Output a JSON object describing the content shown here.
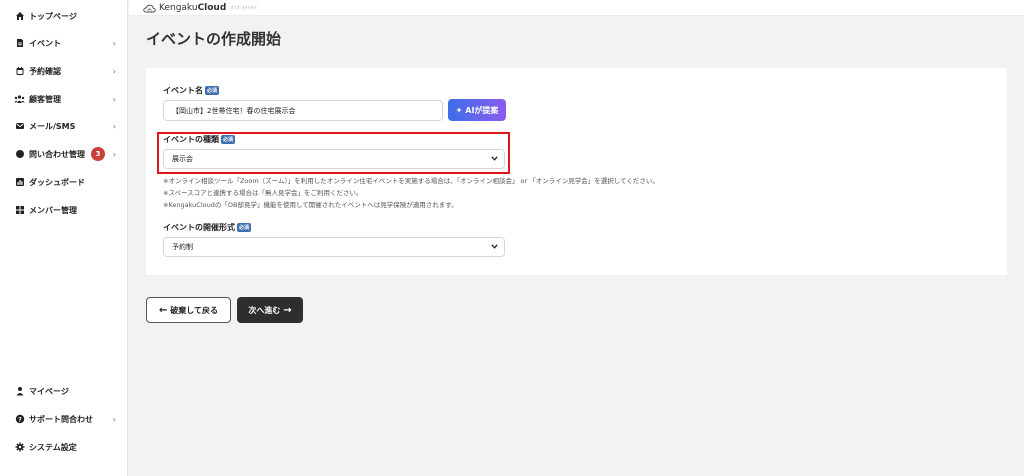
{
  "sidebar": {
    "items": [
      {
        "label": "トップページ",
        "icon": "home-icon",
        "chevron": false
      },
      {
        "label": "イベント",
        "icon": "document-icon",
        "chevron": true
      },
      {
        "label": "予約確認",
        "icon": "calendar-icon",
        "chevron": true
      },
      {
        "label": "顧客管理",
        "icon": "users-icon",
        "chevron": true
      },
      {
        "label": "メール/SMS",
        "icon": "mail-icon",
        "chevron": true
      },
      {
        "label": "問い合わせ管理",
        "icon": "chat-icon",
        "chevron": true,
        "badge": "3"
      },
      {
        "label": "ダッシュボード",
        "icon": "chart-icon",
        "chevron": false
      },
      {
        "label": "メンバー管理",
        "icon": "grid-icon",
        "chevron": false
      }
    ],
    "bottom_items": [
      {
        "label": "マイページ",
        "icon": "person-icon",
        "chevron": false
      },
      {
        "label": "サポート問合わせ",
        "icon": "help-icon",
        "chevron": true
      },
      {
        "label": "システム設定",
        "icon": "gear-icon",
        "chevron": false
      }
    ]
  },
  "header": {
    "logo_prefix": "Kengaku",
    "logo_bold": "Cloud",
    "logo_sub": "ｹﾝｶﾞｸｸﾗｳﾄﾞ"
  },
  "page": {
    "title": "イベントの作成開始"
  },
  "form": {
    "required_label": "必須",
    "event_name": {
      "label": "イベント名",
      "value": "【岡山市】2世帯住宅！春の住宅展示会"
    },
    "ai_button_label": "AIが提案",
    "event_type": {
      "label": "イベントの種類",
      "selected": "展示会"
    },
    "notes": [
      "※オンライン相談ツール「Zoom（ズーム）」を利用したオンライン住宅イベントを実施する場合は、「オンライン相談会」 or 「オンライン見学会」を選択してください。",
      "※スペースコアと連携する場合は「無人見学会」をご利用ください。",
      "※KengakuCloudの「OB邸見学」機能を使用して開催されたイベントへは見学保険が適用されます。"
    ],
    "event_format": {
      "label": "イベントの開催形式",
      "selected": "予約制"
    }
  },
  "actions": {
    "back_label": "破棄して戻る",
    "next_label": "次へ進む"
  },
  "colors": {
    "badge": "#c9403c",
    "highlight": "#e1161b",
    "ai_gradient_start": "#3d6ee8",
    "ai_gradient_end": "#8a5cf0",
    "required": "#3f6faf"
  }
}
